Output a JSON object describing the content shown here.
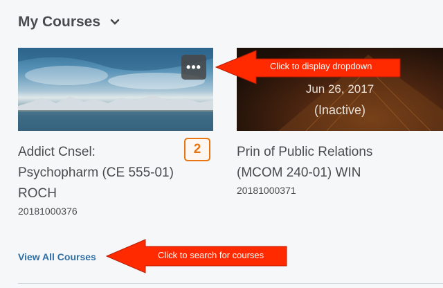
{
  "header": {
    "title": "My Courses",
    "chevron_icon": "chevron-down-icon"
  },
  "courses": [
    {
      "title_lines": [
        "Addict Cnsel:",
        "Psychopharm (CE 555-01)",
        "ROCH"
      ],
      "code": "20181000376",
      "badge": "2",
      "more_label": "•••"
    },
    {
      "title_lines": [
        "Prin of Public Relations",
        "(MCOM 240-01) WIN"
      ],
      "code": "20181000371",
      "date": "Jun 26, 2017",
      "status": "(Inactive)"
    }
  ],
  "links": {
    "view_all": "View All Courses"
  },
  "annotations": {
    "dropdown": "Click to display dropdown",
    "search": "Click to search for courses"
  },
  "colors": {
    "accent": "#e87511",
    "link": "#2f6ea7",
    "callout": "#ff2a00"
  }
}
